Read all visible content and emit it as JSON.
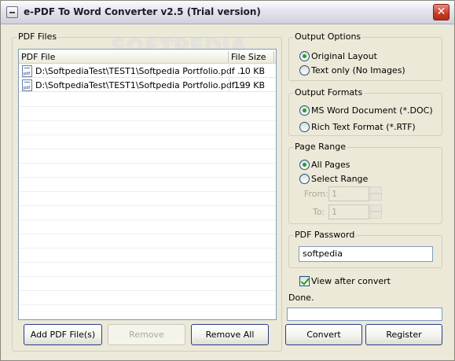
{
  "window": {
    "title": "e-PDF To Word Converter v2.5 (Trial version)",
    "close_glyph": "✕",
    "watermark": "SOFTPEDIA"
  },
  "pdf_files": {
    "group_label": "PDF Files",
    "columns": [
      "PDF File",
      "File Size"
    ],
    "rows": [
      {
        "path": "D:\\SoftpediaTest\\TEST1\\Softpedia Portfolio.pdf ...",
        "size": "10 KB"
      },
      {
        "path": "D:\\SoftpediaTest\\TEST1\\Softpedia Portfolio.pdf ...",
        "size": "199 KB"
      }
    ],
    "buttons": {
      "add": "Add PDF File(s)",
      "remove": "Remove",
      "remove_all": "Remove All"
    }
  },
  "output_options": {
    "label": "Output Options",
    "original_layout": "Original Layout",
    "text_only": "Text only (No Images)",
    "selected": "original_layout"
  },
  "output_formats": {
    "label": "Output Formats",
    "doc": "MS Word Document (*.DOC)",
    "rtf": "Rich Text Format (*.RTF)",
    "selected": "doc"
  },
  "page_range": {
    "label": "Page Range",
    "all_pages": "All Pages",
    "select_range": "Select Range",
    "from_label": "From:",
    "to_label": "To:",
    "from_value": "1",
    "to_value": "1",
    "selected": "all_pages"
  },
  "pdf_password": {
    "label": "PDF Password",
    "value": "softpedia"
  },
  "view_after_convert": {
    "label": "View after convert",
    "checked": true
  },
  "status": {
    "text": "Done.",
    "progress": 0
  },
  "actions": {
    "convert": "Convert",
    "register": "Register"
  },
  "colors": {
    "window_bg": "#ece9d8",
    "radio_dot": "#21a121",
    "border_blue": "#7f9db9"
  }
}
